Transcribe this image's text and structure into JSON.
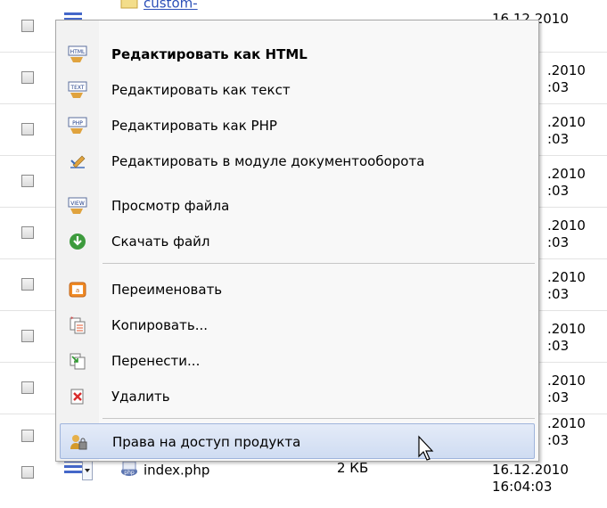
{
  "rows": [
    {
      "date1": "16.12.2010",
      "date2": ":03"
    },
    {
      "date1": ".2010",
      "date2": ":03"
    },
    {
      "date1": ".2010",
      "date2": ":03"
    },
    {
      "date1": ".2010",
      "date2": ":03"
    },
    {
      "date1": ".2010",
      "date2": ":03"
    },
    {
      "date1": ".2010",
      "date2": ":03"
    },
    {
      "date1": ".2010",
      "date2": ":03"
    },
    {
      "date1": ".2010",
      "date2": ":03"
    },
    {
      "date1": "16.12.2010",
      "date2": "16:04:03"
    }
  ],
  "top_folder": {
    "name": "custom-"
  },
  "bottom_file": {
    "name": "index.php",
    "size": "2 КБ"
  },
  "menu": {
    "items": [
      {
        "label": "Редактировать как HTML",
        "icon": "html-edit-icon"
      },
      {
        "label": "Редактировать как текст",
        "icon": "text-edit-icon"
      },
      {
        "label": "Редактировать как PHP",
        "icon": "php-edit-icon"
      },
      {
        "label": "Редактировать в модуле документооборота",
        "icon": "workflow-edit-icon"
      },
      {
        "label": "Просмотр файла",
        "icon": "view-file-icon"
      },
      {
        "label": "Скачать файл",
        "icon": "download-icon"
      },
      {
        "label": "Переименовать",
        "icon": "rename-icon"
      },
      {
        "label": "Копировать...",
        "icon": "copy-icon"
      },
      {
        "label": "Перенести...",
        "icon": "move-icon"
      },
      {
        "label": "Удалить",
        "icon": "delete-icon"
      },
      {
        "label": "Права на доступ продукта",
        "icon": "access-rights-icon"
      }
    ],
    "hovered_item": "Права на доступ продукта"
  },
  "colors": {
    "accent": "#4467c9",
    "link": "#2c50b8",
    "hover": "#cfdcf2"
  }
}
